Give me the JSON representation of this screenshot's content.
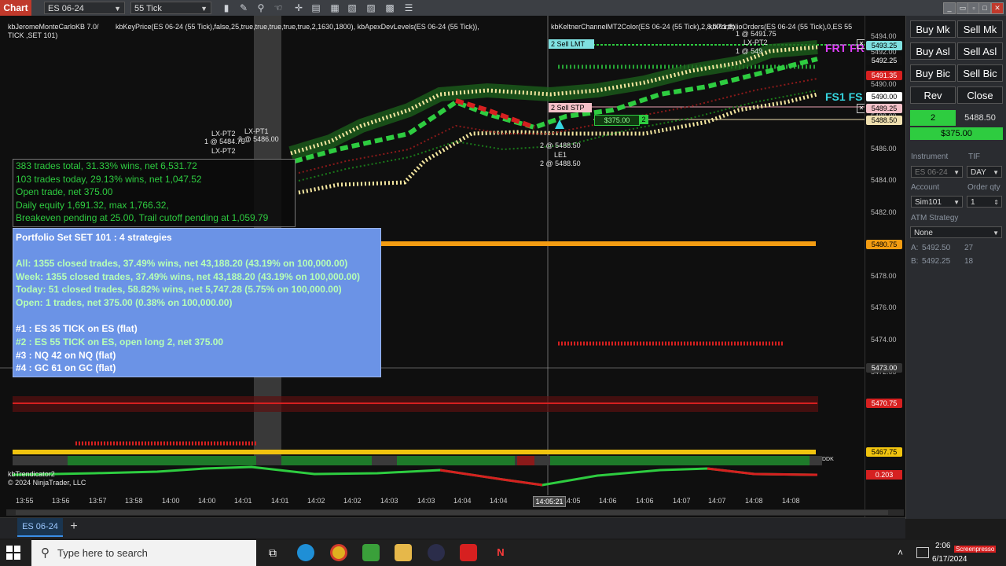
{
  "titlebar": {
    "app_label": "Chart",
    "instrument_select": "ES 06-24",
    "period_select": "55 Tick",
    "tool_icons": [
      "bar-chart-icon",
      "pencil-icon",
      "zoom-icon",
      "crosshair-icon",
      "data-box-icon",
      "strategies-icon",
      "indicators-icon",
      "templates-icon",
      "properties-icon"
    ]
  },
  "indicators": {
    "line1": "kbJeromeMonteCarloKB 7.0/",
    "line1b": "TICK ,SET 101)",
    "keyprice": "kbKeyPrice(ES 06-24 (55 Tick),false,25,true,true,true,true,true,2,1630,1800), kbApexDevLevels(ES 06-24 (55 Tick)),",
    "keltner": "kbKeltnerChannelMT2Color(ES 06-24 (55 Tick),2,8,0.01,8),",
    "portfolio": "kbPortfolioOrders(ES 06-24 (55 Tick),0,ES  55"
  },
  "stats": {
    "line1": "383 trades total, 31.33% wins, net 6,531.72",
    "line2": "103 trades today, 29.13% wins, net 1,047.52",
    "line3": "Open trade, net 375.00",
    "line4": "Daily equity 1,691.32, max 1,766.32,",
    "line5": "Breakeven pending at 25.00, Trail cutoff pending at 1,059.79"
  },
  "portfolio_box": {
    "title": "Portfolio Set SET 101 : 4 strategies",
    "all": "All: 1355 closed trades, 37.49% wins, net 43,188.20 (43.19% on 100,000.00)",
    "week": "Week: 1355 closed trades, 37.49% wins, net 43,188.20 (43.19% on 100,000.00)",
    "today": "Today: 51 closed trades, 58.82% wins, net 5,747.28 (5.75% on 100,000.00)",
    "open": "Open: 1 trades, net 375.00 (0.38% on 100,000.00)",
    "s1": "#1 : ES  35 TICK  on ES (flat)",
    "s2": "#2 : ES  55 TICK  on ES, open long 2, net 375.00",
    "s3": "#3 : NQ   42 on NQ (flat)",
    "s4": "#4 : GC 61 on GC (flat)"
  },
  "chart_labels": {
    "lx_pt2_a": "LX-PT2",
    "lx_pt1": "LX-PT1",
    "lx_pt2_fill_a": "1 @ 5484.75",
    "lx_pt1_fill": "2 @ 5486.00",
    "lx_pt2_b": "LX-PT2",
    "sell_lmt": "2  Sell LMT",
    "sell_stp": "2  Sell STP",
    "pnl_tag": "$375.00",
    "pnl_qty": "2",
    "le1_fill": "2 @ 5488.50",
    "le1": "LE1",
    "le1_fill2": "2 @ 5488.50",
    "top_fill1": "1 @ 5491.75",
    "top_lx": "LX-PT2",
    "top_fill2": "1 @ 549",
    "frt": "FRT FR",
    "fs1": "FS1 FS",
    "ddk": "DDK",
    "crosshair_time": "14:05:21",
    "crosshair_price": "5473.00"
  },
  "price_axis": {
    "labels": [
      "5494.00",
      "5492.00",
      "5490.00",
      "5488.00",
      "5486.00",
      "5484.00",
      "5482.00",
      "5480.00",
      "5478.00",
      "5476.00",
      "5474.00",
      "5472.00",
      "5470.00"
    ],
    "tags": [
      {
        "name": "price-tag-sell-lmt",
        "text": "5493.25",
        "bg": "#7fe0e0",
        "fg": "#000"
      },
      {
        "name": "price-tag-upper",
        "text": "5492.25",
        "bg": "#111",
        "fg": "#fff"
      },
      {
        "name": "price-tag-red1",
        "text": "5491.35",
        "bg": "#d62020",
        "fg": "#fff"
      },
      {
        "name": "price-tag-last",
        "text": "5490.00",
        "bg": "#ffffff",
        "fg": "#000"
      },
      {
        "name": "price-tag-sell-stp",
        "text": "5489.25",
        "bg": "#f4c0c8",
        "fg": "#000"
      },
      {
        "name": "price-tag-entry",
        "text": "5488.50",
        "bg": "#f0e0b0",
        "fg": "#000"
      },
      {
        "name": "price-tag-orange",
        "text": "5480.75",
        "bg": "#f39c12",
        "fg": "#000"
      },
      {
        "name": "price-tag-crosshair",
        "text": "5473.00",
        "bg": "#333",
        "fg": "#fff"
      },
      {
        "name": "price-tag-red2",
        "text": "5470.75",
        "bg": "#d62020",
        "fg": "#fff"
      },
      {
        "name": "price-tag-yellow",
        "text": "5467.75",
        "bg": "#f1c40f",
        "fg": "#000"
      }
    ],
    "trend_value": "0.203"
  },
  "trend_panel": {
    "label": "kbTrendicator2",
    "copyright": "© 2024 NinjaTrader, LLC"
  },
  "time_axis": [
    "13:55",
    "13:56",
    "13:57",
    "13:58",
    "14:00",
    "14:00",
    "14:01",
    "14:01",
    "14:02",
    "14:02",
    "14:03",
    "14:03",
    "14:04",
    "14:04",
    "14:05",
    "14:06",
    "14:06",
    "14:07",
    "14:07",
    "14:08",
    "14:08"
  ],
  "right_panel": {
    "buy_mkt": "Buy Mk",
    "sell_mkt": "Sell Mk",
    "buy_ask": "Buy Asl",
    "sell_ask": "Sell Asl",
    "buy_bid": "Buy Bic",
    "sell_bid": "Sell Bic",
    "rev": "Rev",
    "close": "Close",
    "position_qty": "2",
    "position_price": "5488.50",
    "position_pnl": "$375.00",
    "instrument_label": "Instrument",
    "tif_label": "TIF",
    "instrument_value": "ES 06-24",
    "tif_value": "DAY",
    "account_label": "Account",
    "order_qty_label": "Order qty",
    "account_value": "Sim101",
    "order_qty_value": "1",
    "atm_label": "ATM Strategy",
    "atm_value": "None",
    "ask_label": "A:",
    "ask_price": "5492.50",
    "ask_size": "27",
    "bid_label": "B:",
    "bid_price": "5492.25",
    "bid_size": "18"
  },
  "tabs": {
    "active": "ES 06-24",
    "add": "+"
  },
  "taskbar": {
    "search_placeholder": "Type here to search",
    "time": "2:06",
    "date": "6/17/2024",
    "watermark": "Screenpresso"
  },
  "colors": {
    "chart_bg": "#0f0f0f",
    "sell_red": "#d62020",
    "buy_green": "#2ecc40",
    "portfolio_blue": "#6b93e6",
    "orange_line": "#f39c12",
    "yellow_line": "#f1c40f"
  }
}
